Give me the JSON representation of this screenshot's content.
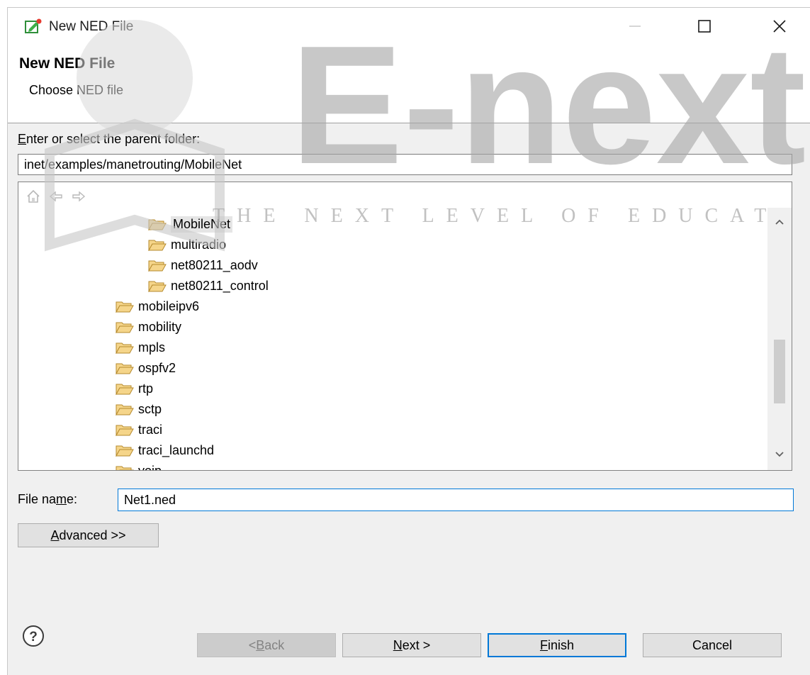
{
  "window": {
    "title": "New NED File",
    "controls": {
      "minimize": "minimize-icon",
      "maximize": "maximize-icon",
      "close": "close-icon"
    }
  },
  "header": {
    "title": "New NED File",
    "subtitle": "Choose NED file"
  },
  "parent_folder": {
    "label_pre": "E",
    "label_rest": "nter or select the parent folder:",
    "value": "inet/examples/manetrouting/MobileNet"
  },
  "tree": {
    "toolbar_icons": [
      "home-icon",
      "back-arrow-icon",
      "forward-arrow-icon"
    ],
    "items": [
      {
        "label": "MobileNet",
        "level": 2,
        "selected": true
      },
      {
        "label": "multiradio",
        "level": 2
      },
      {
        "label": "net80211_aodv",
        "level": 2
      },
      {
        "label": "net80211_control",
        "level": 2
      },
      {
        "label": "mobileipv6",
        "level": 1
      },
      {
        "label": "mobility",
        "level": 1
      },
      {
        "label": "mpls",
        "level": 1
      },
      {
        "label": "ospfv2",
        "level": 1
      },
      {
        "label": "rtp",
        "level": 1
      },
      {
        "label": "sctp",
        "level": 1
      },
      {
        "label": "traci",
        "level": 1
      },
      {
        "label": "traci_launchd",
        "level": 1
      },
      {
        "label": "voip",
        "level": 1
      }
    ]
  },
  "file_name": {
    "label_pre": "File na",
    "label_mnemonic": "m",
    "label_post": "e:",
    "value": "Net1.ned"
  },
  "buttons": {
    "advanced_mnemonic": "A",
    "advanced_rest": "dvanced >>",
    "back_pre": "< ",
    "back_mnemonic": "B",
    "back_rest": "ack",
    "next_mnemonic": "N",
    "next_rest": "ext >",
    "finish_mnemonic": "F",
    "finish_rest": "inish",
    "cancel": "Cancel"
  },
  "watermark": {
    "logo_text": "E-next",
    "tagline": "THE NEXT LEVEL OF EDUCAT"
  },
  "colors": {
    "accent": "#0078d7",
    "dialog_bg": "#f0f0f0",
    "folder_fill": "#f5d58a",
    "folder_stroke": "#b58a2e",
    "watermark_gray": "#b0b0b0"
  }
}
